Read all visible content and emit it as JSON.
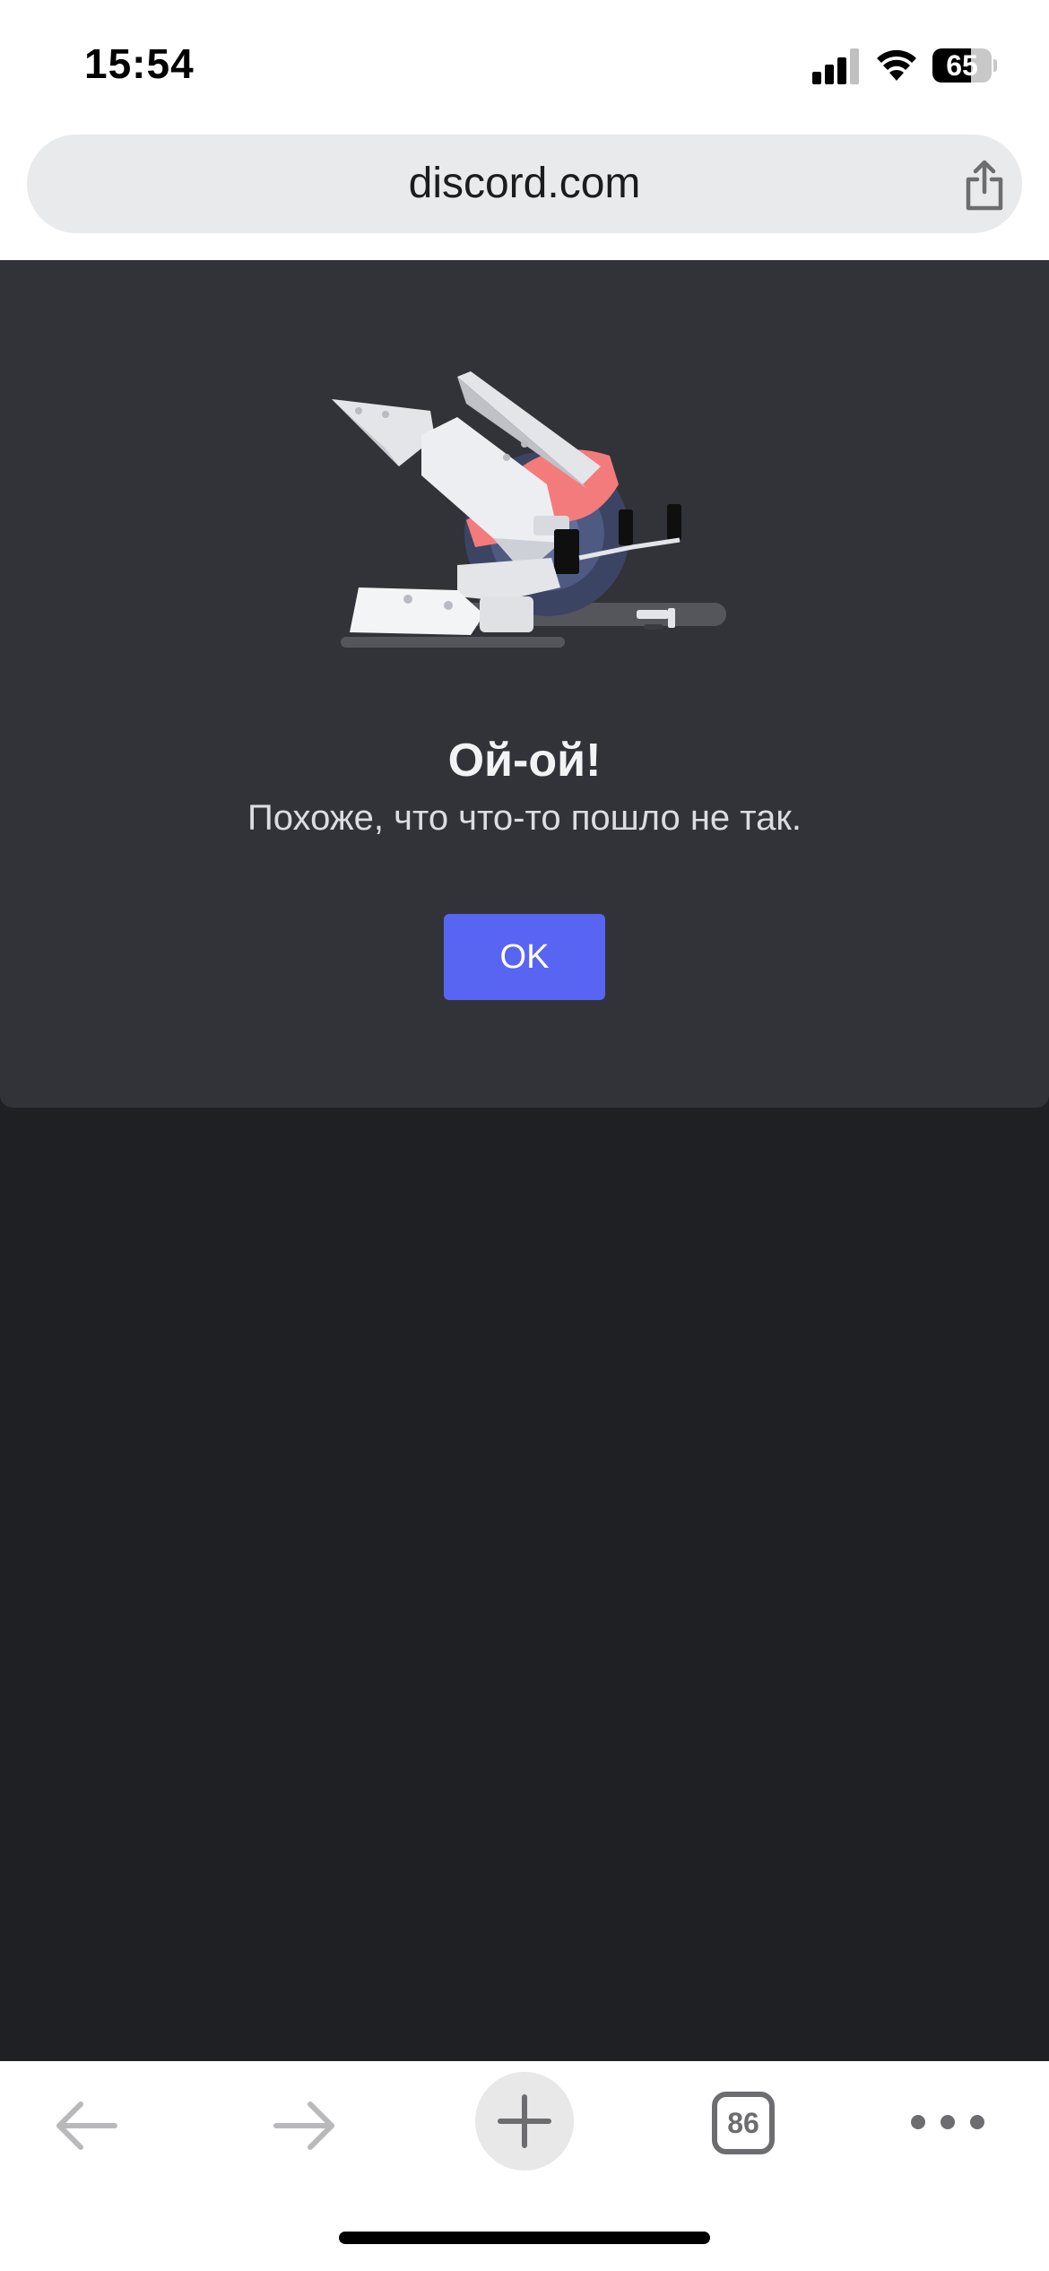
{
  "status_bar": {
    "time": "15:54",
    "battery_level": "65",
    "battery_fraction": 0.65,
    "icons": [
      "signal-icon",
      "wifi-icon",
      "battery-icon"
    ]
  },
  "browser": {
    "url": "discord.com",
    "share_icon": "share-icon",
    "tabs_count": "86",
    "toolbar_icons": [
      "back-arrow-icon",
      "forward-arrow-icon",
      "plus-icon",
      "tabs-icon",
      "more-icon"
    ]
  },
  "error": {
    "illustration": "miter-saw-illustration",
    "title": "Ой-ой!",
    "message": "Похоже, что что-то пошло не так.",
    "button_label": "OK"
  },
  "colors": {
    "card_background": "#313338",
    "page_background": "#1f2024",
    "button": "#5865f2",
    "saw_accent": "#f47b7b"
  }
}
